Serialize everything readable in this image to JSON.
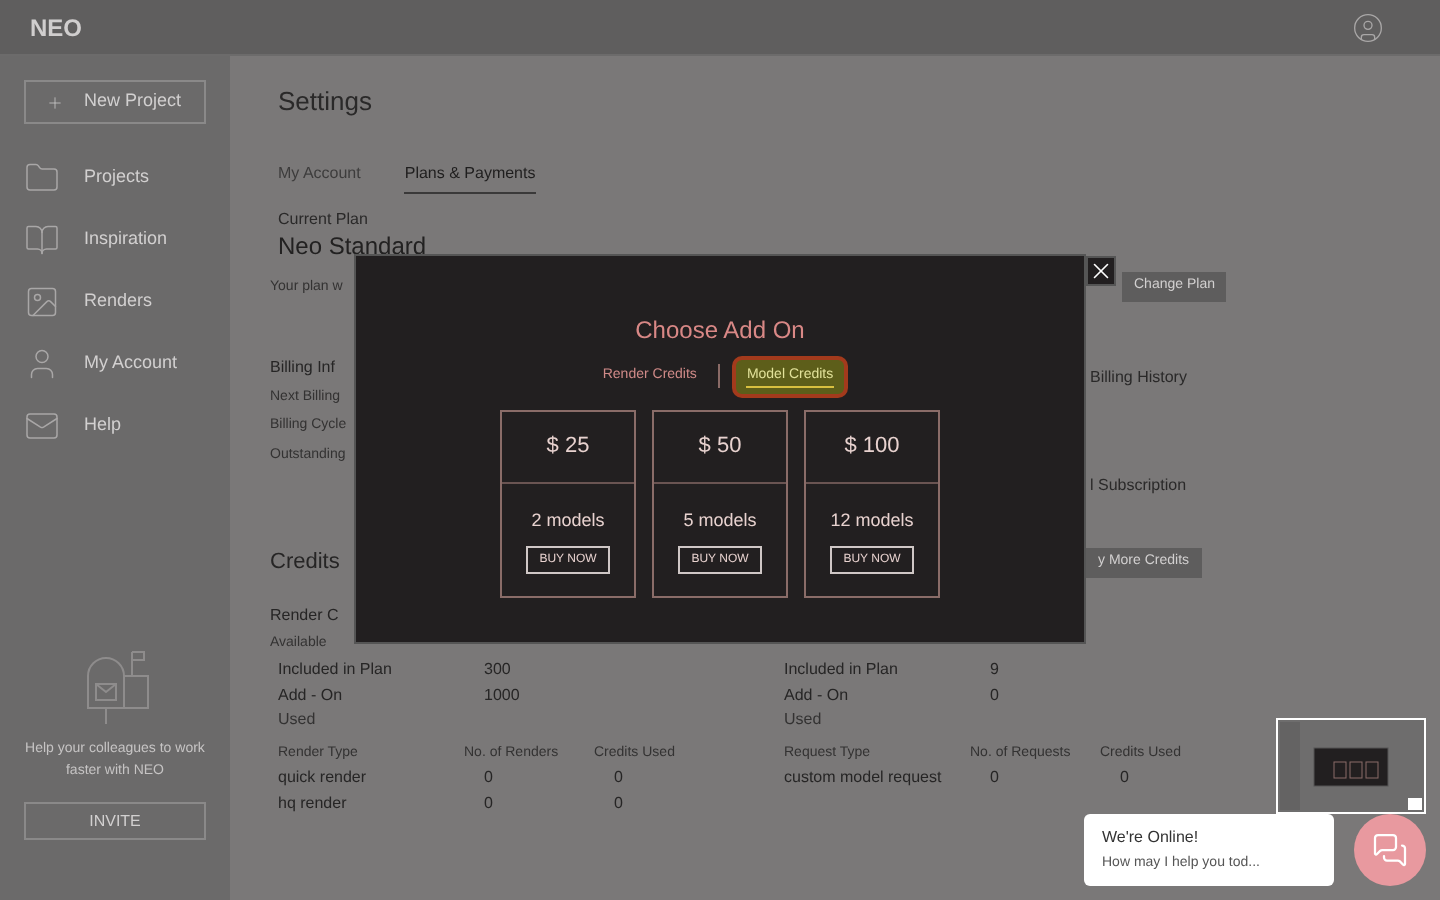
{
  "header": {
    "logo": "NEO"
  },
  "sidebar": {
    "new_project": "New Project",
    "items": [
      {
        "kind": "folder",
        "label": "Projects"
      },
      {
        "kind": "book",
        "label": "Inspiration"
      },
      {
        "kind": "image",
        "label": "Renders"
      },
      {
        "kind": "person",
        "label": "My Account"
      },
      {
        "kind": "mail",
        "label": "Help"
      }
    ],
    "invite_text": "Help your colleagues to work faster with NEO",
    "invite_button": "INVITE"
  },
  "main": {
    "title": "Settings",
    "tabs": [
      {
        "label": "My Account",
        "selected": false
      },
      {
        "label": "Plans & Payments",
        "selected": true
      }
    ],
    "current_plan_label": "Current Plan",
    "plan_name": "Neo Standard",
    "plan_note": "Your plan w",
    "change_plan_button": "Change Plan",
    "billing_heading": "Billing Inf",
    "billing_rows": [
      "Next Billing",
      "Billing Cycle",
      "Outstanding"
    ],
    "billing_history_link": "Billing History",
    "subscription_link": "l Subscription",
    "credits_heading": "Credits",
    "buy_more_button": "y More Credits",
    "render_heading": "Render C",
    "available_label": "Available",
    "sections": [
      {
        "summary": [
          {
            "label": "Included in Plan",
            "value": "300"
          },
          {
            "label": "Add - On",
            "value": "1000"
          }
        ],
        "used_label": "Used",
        "columns": [
          "Render Type",
          "No. of Renders",
          "Credits Used"
        ],
        "rows": [
          [
            "quick render",
            "0",
            "0"
          ],
          [
            "hq render",
            "0",
            "0"
          ]
        ]
      },
      {
        "summary": [
          {
            "label": "Included in Plan",
            "value": "9"
          },
          {
            "label": "Add - On",
            "value": "0"
          }
        ],
        "used_label": "Used",
        "columns": [
          "Request Type",
          "No. of Requests",
          "Credits Used"
        ],
        "rows": [
          [
            "custom model request",
            "0",
            "0"
          ]
        ]
      }
    ]
  },
  "modal": {
    "title": "Choose Add On",
    "tabs": [
      {
        "label": "Render Credits",
        "selected": false
      },
      {
        "label": "Model Credits",
        "selected": true
      }
    ],
    "cards": [
      {
        "price": "$ 25",
        "quantity": "2 models",
        "button": "BUY NOW"
      },
      {
        "price": "$ 50",
        "quantity": "5 models",
        "button": "BUY NOW"
      },
      {
        "price": "$ 100",
        "quantity": "12 models",
        "button": "BUY NOW"
      }
    ]
  },
  "chat": {
    "title": "We're Online!",
    "message": "How may I help you tod..."
  }
}
